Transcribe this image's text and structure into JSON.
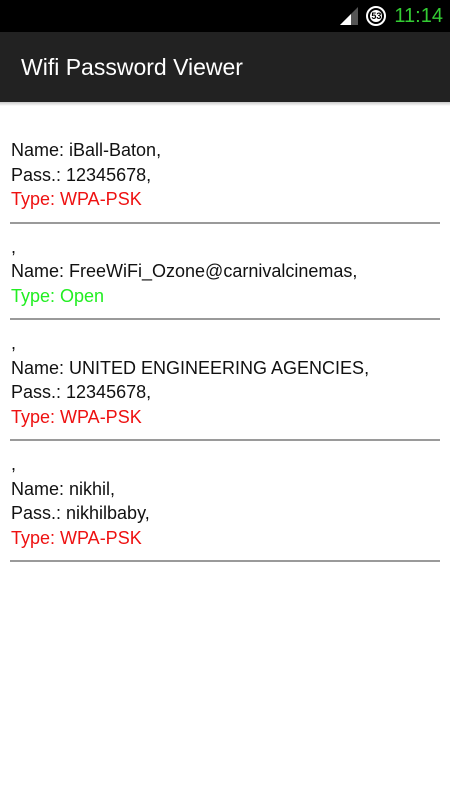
{
  "status_bar": {
    "time": "11:14",
    "battery": "53",
    "signal_icon": "signal-icon",
    "battery_icon": "battery-icon",
    "clock_color": "#33cc33"
  },
  "action_bar": {
    "title": "Wifi Password Viewer"
  },
  "colors": {
    "wpa": "#ee1111",
    "open": "#22ee22"
  },
  "networks": [
    {
      "prefix": "",
      "name": "Name: iBall-Baton,",
      "pass": "Pass.: 12345678,",
      "type": "Type: WPA-PSK",
      "type_color": "#ee1111"
    },
    {
      "prefix": ",",
      "name": "Name: FreeWiFi_Ozone@carnivalcinemas,",
      "pass": "",
      "type": "Type: Open",
      "type_color": "#22ee22"
    },
    {
      "prefix": ",",
      "name": "Name: UNITED ENGINEERING AGENCIES,",
      "pass": "Pass.: 12345678,",
      "type": "Type: WPA-PSK",
      "type_color": "#ee1111"
    },
    {
      "prefix": ",",
      "name": "Name: nikhil,",
      "pass": "Pass.: nikhilbaby,",
      "type": "Type: WPA-PSK",
      "type_color": "#ee1111"
    }
  ]
}
